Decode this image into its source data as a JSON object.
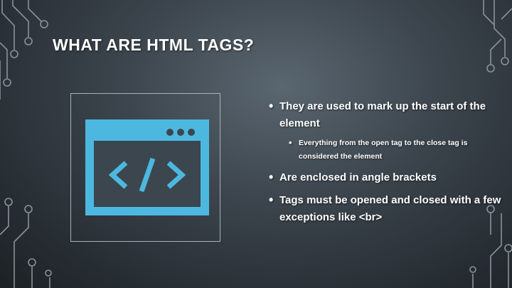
{
  "slide": {
    "title": "What are HTML Tags?",
    "bullets": [
      {
        "text": "They are used to mark up the start of the element",
        "sub": [
          "Everything from the open tag to the close tag is considered the element"
        ]
      },
      {
        "text": "Are enclosed in angle brackets",
        "sub": []
      },
      {
        "text": "Tags must be opened and closed with a few exceptions like <br>",
        "sub": []
      }
    ]
  },
  "icon": {
    "name": "code-window-icon",
    "symbol": "</>"
  },
  "colors": {
    "accent": "#4db8df",
    "text": "#ffffff",
    "decor": "#8a9299"
  }
}
